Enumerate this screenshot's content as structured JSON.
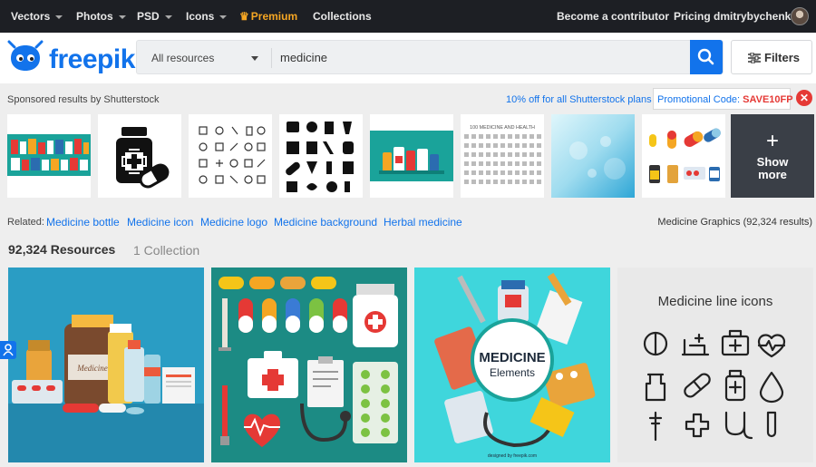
{
  "topnav": {
    "vectors": "Vectors",
    "photos": "Photos",
    "psd": "PSD",
    "icons": "Icons",
    "premium": "Premium",
    "collections": "Collections",
    "contributor": "Become a contributor",
    "pricing": "Pricing",
    "username": "dmitrybychenko"
  },
  "search": {
    "logo": "freepik",
    "resource_type": "All resources",
    "query": "medicine",
    "filters": "Filters"
  },
  "sponsored": {
    "label": "Sponsored results by Shutterstock",
    "offer": "10% off for all Shutterstock plans",
    "code_label": "Promotional Code:",
    "code": "SAVE10FP",
    "show_more": "Show more",
    "thumb7_title": "100 MEDICINE AND HEALTH"
  },
  "related": {
    "label": "Related:",
    "tags": [
      "Medicine bottle",
      "Medicine icon",
      "Medicine logo",
      "Medicine background",
      "Herbal medicine"
    ],
    "graphics_count": "Medicine Graphics (92,324 results)"
  },
  "results": {
    "resources": "92,324 Resources",
    "collection": "1 Collection",
    "tile3_title1": "MEDICINE",
    "tile3_title2": "Elements",
    "tile3_credit": "designed by freepik.com",
    "tile4_title": "Medicine line icons"
  },
  "colors": {
    "brand_blue": "#1273eb",
    "premium_gold": "#f5a623",
    "promo_red": "#e53935"
  }
}
